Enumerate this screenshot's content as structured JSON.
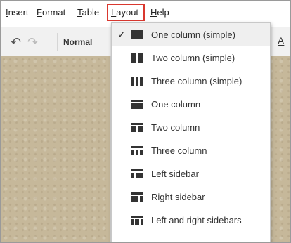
{
  "menubar": {
    "items": [
      {
        "pre": "",
        "mnemonic": "I",
        "post": "nsert"
      },
      {
        "pre": "",
        "mnemonic": "F",
        "post": "ormat"
      },
      {
        "pre": "",
        "mnemonic": "T",
        "post": "able"
      },
      {
        "pre": "",
        "mnemonic": "L",
        "post": "ayout"
      },
      {
        "pre": "",
        "mnemonic": "H",
        "post": "elp"
      }
    ],
    "highlight_color": "#d9382f"
  },
  "toolbar": {
    "style_value": "Normal",
    "undo_icon": "undo-icon",
    "redo_icon": "redo-icon",
    "text_color_label": "A"
  },
  "layout_menu": {
    "items": [
      {
        "label": "One column (simple)",
        "checked": true,
        "icon": "one-column-simple-icon"
      },
      {
        "label": "Two column (simple)",
        "checked": false,
        "icon": "two-column-simple-icon"
      },
      {
        "label": "Three column (simple)",
        "checked": false,
        "icon": "three-column-simple-icon"
      },
      {
        "label": "One column",
        "checked": false,
        "icon": "one-column-icon"
      },
      {
        "label": "Two column",
        "checked": false,
        "icon": "two-column-icon"
      },
      {
        "label": "Three column",
        "checked": false,
        "icon": "three-column-icon"
      },
      {
        "label": "Left sidebar",
        "checked": false,
        "icon": "left-sidebar-icon"
      },
      {
        "label": "Right sidebar",
        "checked": false,
        "icon": "right-sidebar-icon"
      },
      {
        "label": "Left and right sidebars",
        "checked": false,
        "icon": "left-right-sidebars-icon"
      }
    ],
    "check_glyph": "✓"
  }
}
